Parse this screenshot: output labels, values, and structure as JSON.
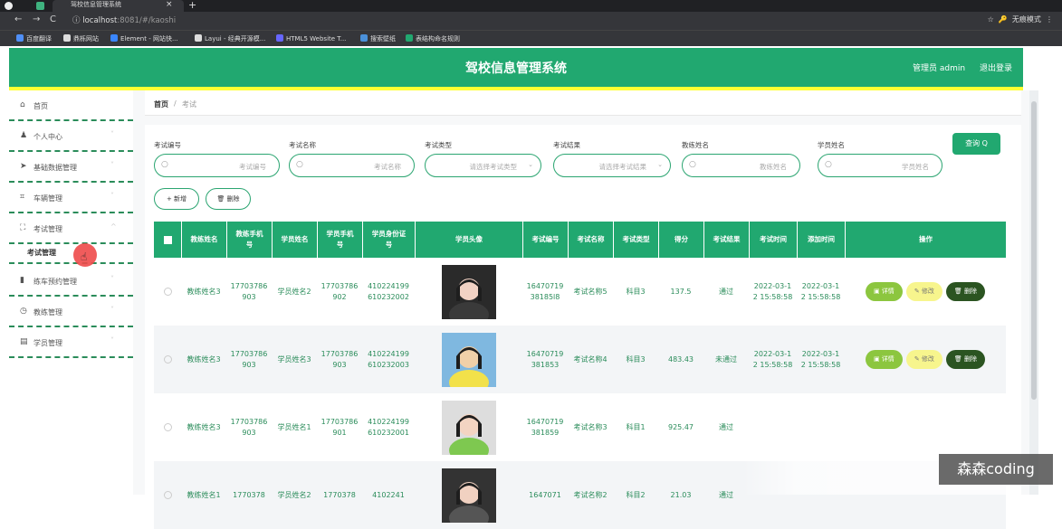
{
  "browser": {
    "tab_title": "驾校信息管理系统",
    "url_host": "localhost",
    "url_rest": ":8081/#/kaoshi",
    "incognito_label": "无痕模式",
    "bookmarks": [
      "百度翻译",
      "鼎栎网站",
      "Element - 网站快...",
      "Layui - 经典开源模...",
      "HTML5 Website T...",
      "搜索壁纸",
      "表结构命名规则"
    ]
  },
  "header": {
    "title": "驾校信息管理系统",
    "user": "管理员 admin",
    "logout": "退出登录"
  },
  "sidebar": {
    "items": [
      {
        "icon": "home-icon",
        "label": "首页",
        "chevron": false
      },
      {
        "icon": "user-icon",
        "label": "个人中心",
        "chevron": true
      },
      {
        "icon": "send-icon",
        "label": "基础数据管理",
        "chevron": true
      },
      {
        "icon": "crop-icon",
        "label": "车辆管理",
        "chevron": true
      },
      {
        "icon": "fullscreen-icon",
        "label": "考试管理",
        "chevron": true
      }
    ],
    "sub_item": "考试管理",
    "items_after": [
      {
        "icon": "chart-icon",
        "label": "练车预约管理"
      },
      {
        "icon": "clock-icon",
        "label": "教练管理"
      },
      {
        "icon": "briefcase-icon",
        "label": "学员管理"
      }
    ]
  },
  "breadcrumb": {
    "home": "首页",
    "separator": "/",
    "current": "考试"
  },
  "filters": [
    {
      "label": "考试编号",
      "placeholder": "考试编号",
      "type": "input"
    },
    {
      "label": "考试名称",
      "placeholder": "考试名称",
      "type": "input"
    },
    {
      "label": "考试类型",
      "placeholder": "请选择考试类型",
      "type": "select"
    },
    {
      "label": "考试结果",
      "placeholder": "请选择考试结果",
      "type": "select"
    },
    {
      "label": "教练姓名",
      "placeholder": "教练姓名",
      "type": "input"
    },
    {
      "label": "学员姓名",
      "placeholder": "学员姓名",
      "type": "input"
    }
  ],
  "search_button": "查询 Q",
  "add_button": "+ 新增",
  "delete_button": "删除",
  "table": {
    "headers": [
      "",
      "教练姓名",
      "教练手机号",
      "学员姓名",
      "学员手机号",
      "学员身份证号",
      "学员头像",
      "考试编号",
      "考试名称",
      "考试类型",
      "得分",
      "考试结果",
      "考试时间",
      "添加时间",
      "操作"
    ],
    "rows": [
      {
        "coach": "教练姓名3",
        "coach_phone": "17703786903",
        "student": "学员姓名2",
        "student_phone": "17703786902",
        "id_card": "410224199610232002",
        "exam_no": "1647071938185l8",
        "exam_name": "考试名称5",
        "exam_type": "科目3",
        "score": "137.5",
        "result": "通过",
        "exam_time": "2022-03-12 15:58:58",
        "add_time": "2022-03-12 15:58:58"
      },
      {
        "coach": "教练姓名3",
        "coach_phone": "17703786903",
        "student": "学员姓名3",
        "student_phone": "17703786903",
        "id_card": "410224199610232003",
        "exam_no": "16470719381853",
        "exam_name": "考试名称4",
        "exam_type": "科目3",
        "score": "483.43",
        "result": "未通过",
        "exam_time": "2022-03-12 15:58:58",
        "add_time": "2022-03-12 15:58:58"
      },
      {
        "coach": "教练姓名3",
        "coach_phone": "17703786903",
        "student": "学员姓名1",
        "student_phone": "17703786901",
        "id_card": "410224199610232001",
        "exam_no": "16470719381859",
        "exam_name": "考试名称3",
        "exam_type": "科目1",
        "score": "925.47",
        "result": "通过",
        "exam_time": "",
        "add_time": ""
      },
      {
        "coach": "教练姓名1",
        "coach_phone": "1770378",
        "student": "学员姓名2",
        "student_phone": "1770378",
        "id_card": "4102241",
        "exam_no": "1647071",
        "exam_name": "考试名称2",
        "exam_type": "科目2",
        "score": "21.03",
        "result": "通过",
        "exam_time": "",
        "add_time": ""
      }
    ],
    "actions": {
      "detail": "详情",
      "edit": "修改",
      "delete": "删除"
    }
  },
  "watermark": "森森coding",
  "colors": {
    "primary": "#21a870",
    "accent": "#ffff33",
    "detail": "#8cc63f",
    "edit": "#f7f58d",
    "delete": "#2b5421"
  }
}
